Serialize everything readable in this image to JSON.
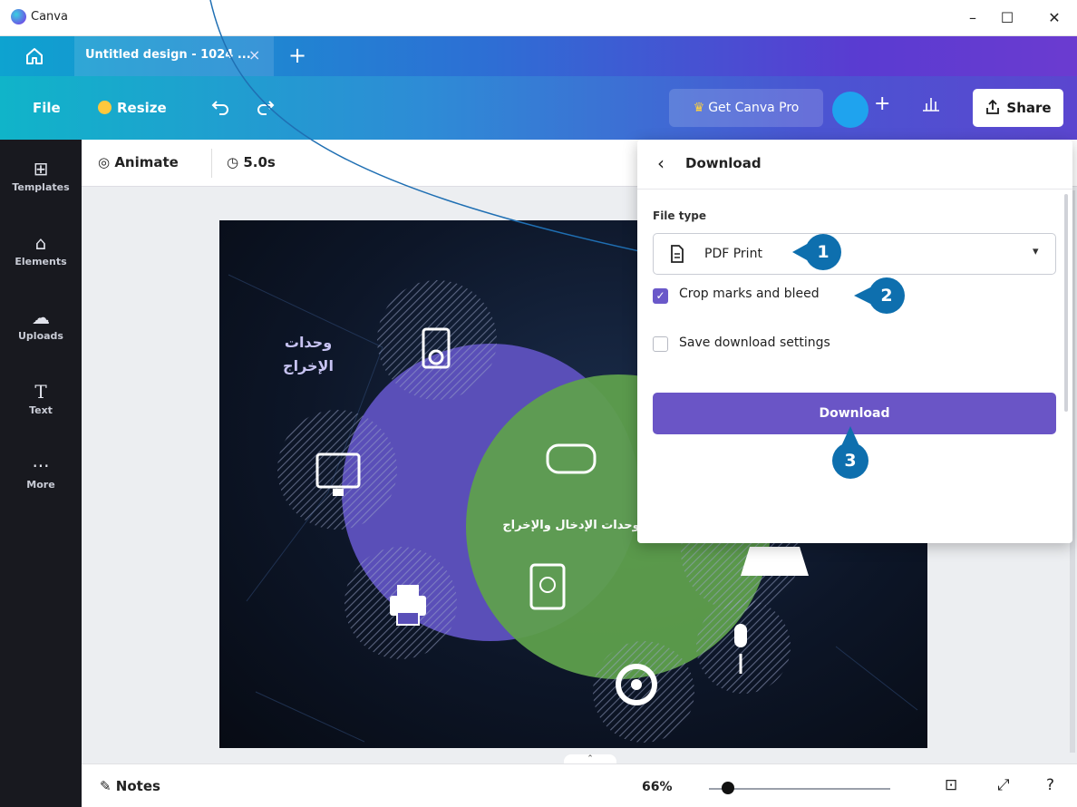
{
  "window": {
    "app_name": "Canva",
    "minimize": "–",
    "maximize": "☐",
    "close": "✕"
  },
  "tabs": {
    "current_tab": "Untitled design - 1024 ...",
    "close": "×",
    "add": "+"
  },
  "toolbar": {
    "file": "File",
    "resize": "Resize",
    "get_pro": "Get Canva Pro",
    "share": "Share",
    "plus": "+"
  },
  "sidebar": {
    "items": [
      {
        "label": "Templates",
        "icon": "templates-icon"
      },
      {
        "label": "Elements",
        "icon": "elements-icon"
      },
      {
        "label": "Uploads",
        "icon": "uploads-icon"
      },
      {
        "label": "Text",
        "icon": "text-icon"
      },
      {
        "label": "More",
        "icon": "more-icon"
      }
    ]
  },
  "context_bar": {
    "animate": "Animate",
    "duration": "5.0s"
  },
  "design": {
    "label_output": "وحدات\nالإخراج",
    "label_center": "وحدات الإدخال والإخراج"
  },
  "download_panel": {
    "title": "Download",
    "file_type_label": "File type",
    "file_type_value": "PDF Print",
    "crop_marks_label": "Crop marks and bleed",
    "crop_marks_checked": true,
    "save_settings_label": "Save download settings",
    "save_settings_checked": false,
    "download_button": "Download"
  },
  "steps": [
    "1",
    "2",
    "3"
  ],
  "bottom": {
    "notes": "Notes",
    "zoom": "66%",
    "zoom_fraction": 0.07
  },
  "colors": {
    "accent": "#6a55c6",
    "step": "#0e6fae",
    "purple_circle": "#5a4fb8",
    "green_circle": "#5fa04c"
  }
}
